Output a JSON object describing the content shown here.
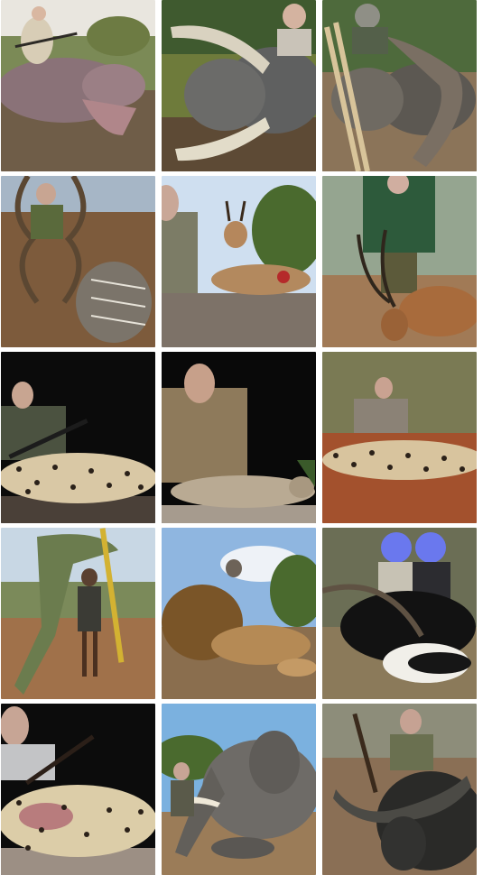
{
  "gallery": {
    "columns": 3,
    "rows": 5,
    "tiles": [
      {
        "subject": "hippo-trophy-photo",
        "sky": "#e9e6df",
        "ground": "#6b5a44"
      },
      {
        "subject": "elephant-tusks-trophy-photo",
        "sky": "#3e5a2f",
        "ground": "#5d4a35"
      },
      {
        "subject": "buffalo-trophy-photo",
        "sky": "#4f6a3c",
        "ground": "#8a7358"
      },
      {
        "subject": "kudu-trophy-photo",
        "sky": "#a4b4c6",
        "ground": "#7d5b3c"
      },
      {
        "subject": "antelope-trophy-photo",
        "sky": "#cfdff0",
        "ground": "#7d7268"
      },
      {
        "subject": "impala-trophy-photo",
        "sky": "#98a893",
        "ground": "#a07a56"
      },
      {
        "subject": "leopard-trophy-photo-night",
        "sky": "#0b0b0b",
        "ground": "#4a4038"
      },
      {
        "subject": "wildcat-trophy-photo-night",
        "sky": "#090909",
        "ground": "#a69b8e"
      },
      {
        "subject": "leopard-trophy-photo-day",
        "sky": "#7a7a54",
        "ground": "#a3512d"
      },
      {
        "subject": "crocodile-trophy-photo",
        "sky": "#c8d7e4",
        "ground": "#a0714a"
      },
      {
        "subject": "lion-trophy-photo",
        "sky": "#8fb6e0",
        "ground": "#8a6e4e"
      },
      {
        "subject": "sable-antelope-trophy-photo",
        "sky": "#6b6e55",
        "ground": "#8b7a5a"
      },
      {
        "subject": "leopard-trophy-photo-night-2",
        "sky": "#0c0c0c",
        "ground": "#9c8f84"
      },
      {
        "subject": "elephant-trophy-photo",
        "sky": "#7bb1df",
        "ground": "#9b7c58"
      },
      {
        "subject": "buffalo-trophy-photo-2",
        "sky": "#8d8d7a",
        "ground": "#8a6f55"
      }
    ]
  }
}
